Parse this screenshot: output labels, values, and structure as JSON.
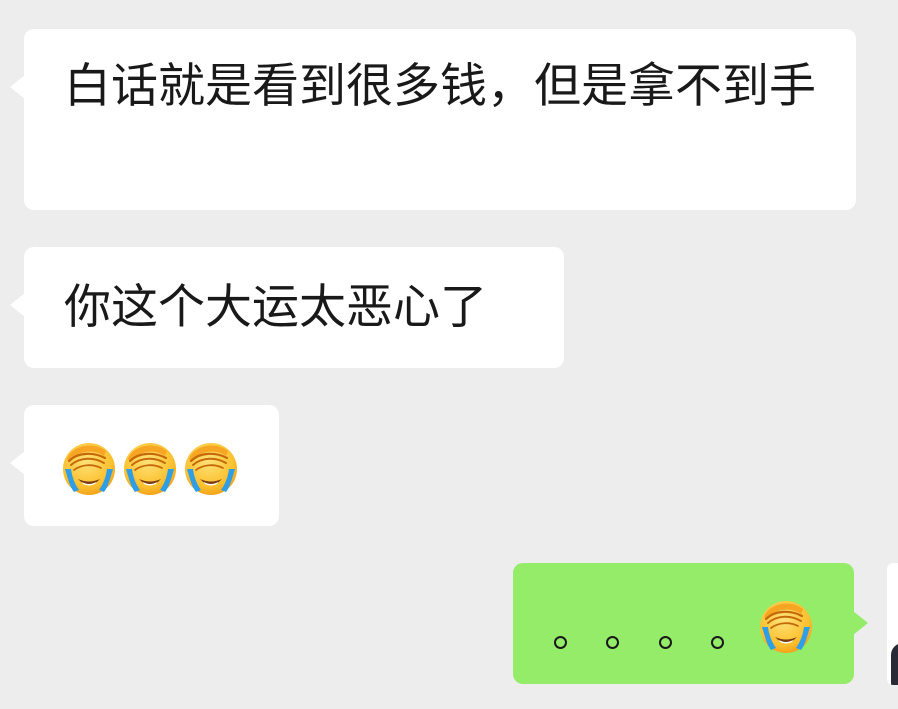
{
  "chat": {
    "messages": [
      {
        "direction": "incoming",
        "text": "白话就是看到很多钱，但是拿不到手"
      },
      {
        "direction": "incoming",
        "text": "你这个大运太恶心了"
      },
      {
        "direction": "incoming",
        "emoji": [
          "face-palm-crying-icon",
          "face-palm-crying-icon",
          "face-palm-crying-icon"
        ]
      },
      {
        "direction": "outgoing",
        "text": "。。。。",
        "emoji": [
          "face-palm-crying-icon"
        ]
      }
    ]
  },
  "colors": {
    "background": "#ededed",
    "incoming_bubble": "#ffffff",
    "outgoing_bubble": "#95ec69",
    "text": "#191919"
  }
}
